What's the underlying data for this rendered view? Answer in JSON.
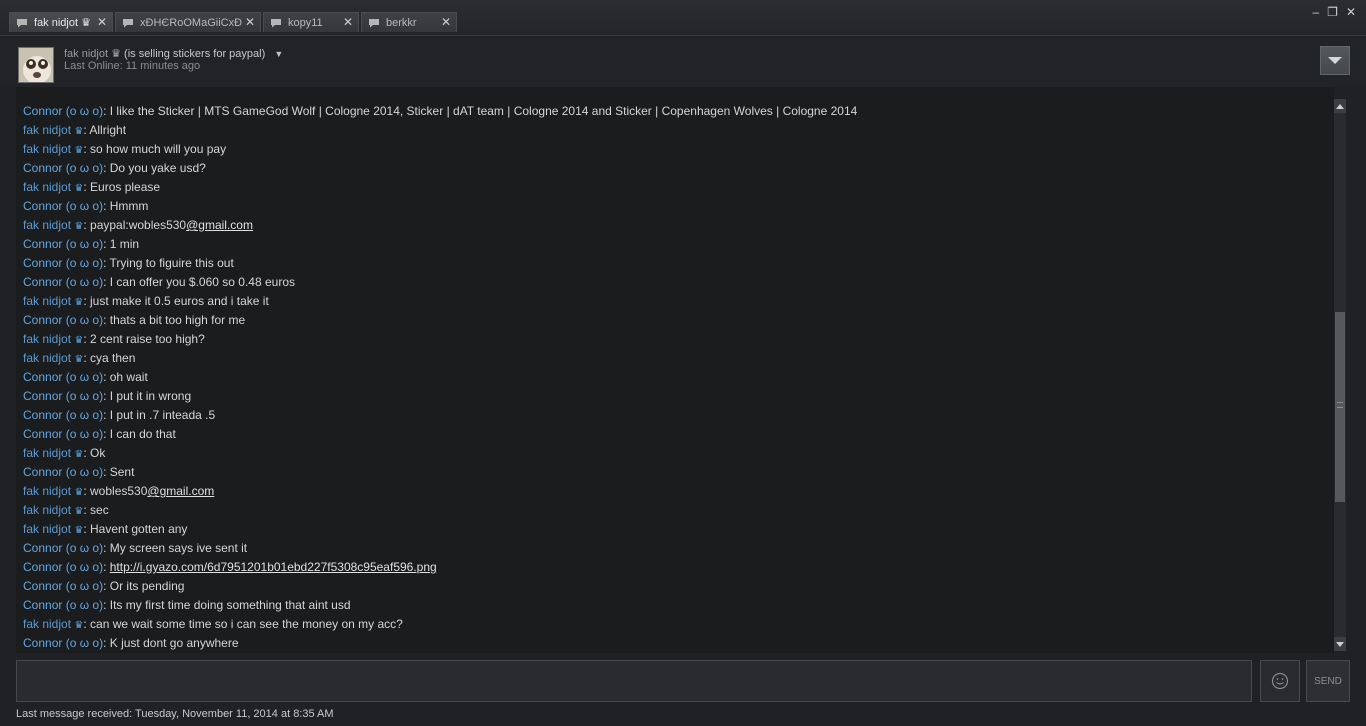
{
  "tabs": [
    {
      "label": "fak nidjot ♛",
      "active": true,
      "width": 104
    },
    {
      "label": "xÐHЄRoOMaGiiCxÐ",
      "active": false,
      "width": 146
    },
    {
      "label": "kopy11",
      "active": false,
      "width": 96
    },
    {
      "label": "berkkr",
      "active": false,
      "width": 96
    }
  ],
  "window": {
    "minimize": "–",
    "restore": "❐",
    "close": "✕"
  },
  "header": {
    "name": "fak nidjot",
    "crown": "♛",
    "status": "(is selling stickers for paypal)",
    "last_online": "Last Online: 11 minutes ago"
  },
  "messages": [
    {
      "who": "Connor (o ω o)",
      "type": "friend",
      "parts": [
        {
          "t": "I like the Sticker | MTS GameGod Wolf | Cologne 2014, Sticker | dAT team | Cologne 2014 and Sticker | Copenhagen Wolves | Cologne 2014"
        }
      ]
    },
    {
      "who": "fak nidjot",
      "type": "me",
      "parts": [
        {
          "t": "Allright"
        }
      ]
    },
    {
      "who": "fak nidjot",
      "type": "me",
      "parts": [
        {
          "t": "so how much will you pay"
        }
      ]
    },
    {
      "who": "Connor (o ω o)",
      "type": "friend",
      "parts": [
        {
          "t": "Do you yake usd?"
        }
      ]
    },
    {
      "who": "fak nidjot",
      "type": "me",
      "parts": [
        {
          "t": "Euros please"
        }
      ]
    },
    {
      "who": "Connor (o ω o)",
      "type": "friend",
      "parts": [
        {
          "t": "Hmmm"
        }
      ]
    },
    {
      "who": "fak nidjot",
      "type": "me",
      "parts": [
        {
          "t": "paypal:wobles530"
        },
        {
          "t": "@gmail.com",
          "link": true
        }
      ]
    },
    {
      "who": "Connor (o ω o)",
      "type": "friend",
      "parts": [
        {
          "t": "1 min"
        }
      ]
    },
    {
      "who": "Connor (o ω o)",
      "type": "friend",
      "parts": [
        {
          "t": "Trying to figuire this out"
        }
      ]
    },
    {
      "who": "Connor (o ω o)",
      "type": "friend",
      "parts": [
        {
          "t": "I can offer you $.060 so 0.48 euros"
        }
      ]
    },
    {
      "who": "fak nidjot",
      "type": "me",
      "parts": [
        {
          "t": "just make it 0.5 euros and i take it"
        }
      ]
    },
    {
      "who": "Connor (o ω o)",
      "type": "friend",
      "parts": [
        {
          "t": "thats a bit too high for me"
        }
      ]
    },
    {
      "who": "fak nidjot",
      "type": "me",
      "parts": [
        {
          "t": "2 cent raise too high?"
        }
      ]
    },
    {
      "who": "fak nidjot",
      "type": "me",
      "parts": [
        {
          "t": "cya then"
        }
      ]
    },
    {
      "who": "Connor (o ω o)",
      "type": "friend",
      "parts": [
        {
          "t": "oh wait"
        }
      ]
    },
    {
      "who": "Connor (o ω o)",
      "type": "friend",
      "parts": [
        {
          "t": "I put it in wrong"
        }
      ]
    },
    {
      "who": "Connor (o ω o)",
      "type": "friend",
      "parts": [
        {
          "t": "I put in .7 inteada .5"
        }
      ]
    },
    {
      "who": "Connor (o ω o)",
      "type": "friend",
      "parts": [
        {
          "t": "I can do that"
        }
      ]
    },
    {
      "who": "fak nidjot",
      "type": "me",
      "parts": [
        {
          "t": "Ok"
        }
      ]
    },
    {
      "who": "Connor (o ω o)",
      "type": "friend",
      "parts": [
        {
          "t": "Sent"
        }
      ]
    },
    {
      "who": "fak nidjot",
      "type": "me",
      "parts": [
        {
          "t": "wobles530"
        },
        {
          "t": "@gmail.com",
          "link": true
        }
      ]
    },
    {
      "who": "fak nidjot",
      "type": "me",
      "parts": [
        {
          "t": "sec"
        }
      ]
    },
    {
      "who": "fak nidjot",
      "type": "me",
      "parts": [
        {
          "t": "Havent gotten any"
        }
      ]
    },
    {
      "who": "Connor (o ω o)",
      "type": "friend",
      "parts": [
        {
          "t": "My screen says ive sent it"
        }
      ]
    },
    {
      "who": "Connor (o ω o)",
      "type": "friend",
      "parts": [
        {
          "t": "http://i.gyazo.com/6d7951201b01ebd227f5308c95eaf596.png",
          "link": true
        }
      ]
    },
    {
      "who": "Connor (o ω o)",
      "type": "friend",
      "parts": [
        {
          "t": "Or its pending"
        }
      ]
    },
    {
      "who": "Connor (o ω o)",
      "type": "friend",
      "parts": [
        {
          "t": "Its my first time doing something that aint usd"
        }
      ]
    },
    {
      "who": "fak nidjot",
      "type": "me",
      "parts": [
        {
          "t": "can we wait some time so i can see the money on my acc?"
        }
      ]
    },
    {
      "who": "Connor (o ω o)",
      "type": "friend",
      "parts": [
        {
          "t": "K just dont go anywhere"
        }
      ]
    }
  ],
  "composer": {
    "send_label": "SEND",
    "placeholder": ""
  },
  "footer": "Last message received: Tuesday, November 11, 2014 at 8:35 AM",
  "colors": {
    "friend_name": "#62a7e3",
    "me_name": "#5a9bd5",
    "background": "#1b1c1e"
  },
  "icons": {
    "tab": "chat-bubble-icon",
    "emoji": "smiley-icon",
    "dropdown": "caret-down-icon"
  }
}
